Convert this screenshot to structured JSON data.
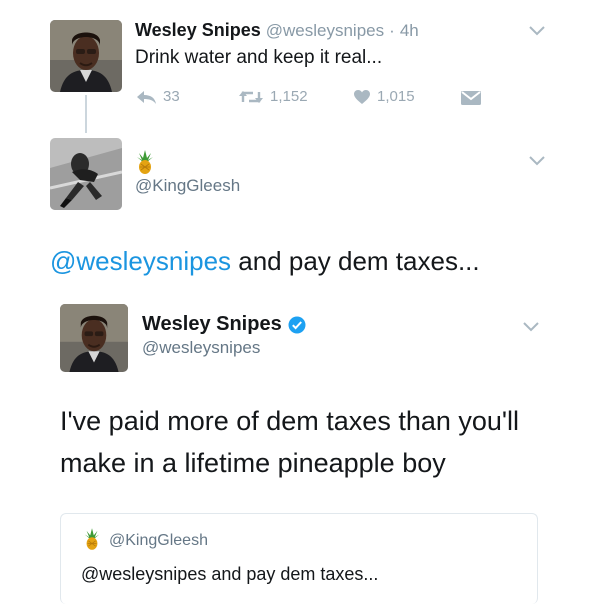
{
  "tweet1": {
    "display_name": "Wesley Snipes",
    "handle": "@wesleysnipes",
    "separator": "·",
    "time": "4h",
    "text": "Drink water and keep it real...",
    "replies": "33",
    "retweets": "1,152",
    "likes": "1,015"
  },
  "tweet2": {
    "name_emoji": "🍍",
    "handle": "@KingGleesh",
    "text_mention": "@wesleysnipes",
    "text_rest": " and pay dem taxes..."
  },
  "tweet3": {
    "display_name": "Wesley Snipes",
    "handle": "@wesleysnipes",
    "text_line1": "I've paid more of dem taxes than you'll",
    "text_line2": "make in a lifetime pineapple boy",
    "quoted": {
      "emoji": "🍍",
      "handle": "@KingGleesh",
      "text": "@wesleysnipes and pay dem taxes..."
    }
  },
  "colors": {
    "link_blue": "#1b95e0",
    "verified_blue": "#1da1f2",
    "gray": "#8899a6",
    "thread_line": "#ccd6dd"
  },
  "icons": [
    "reply-icon",
    "retweet-icon",
    "heart-icon",
    "dm-icon",
    "chevron-down-icon",
    "verified-badge-icon",
    "pineapple-icon"
  ]
}
